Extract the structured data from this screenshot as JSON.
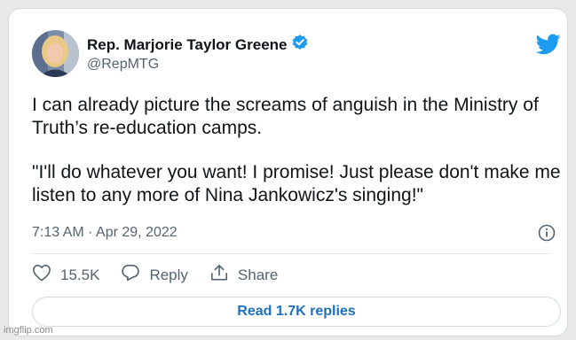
{
  "tweet": {
    "author_name": "Rep. Marjorie Taylor Greene",
    "handle": "@RepMTG",
    "verified": true,
    "paragraphs": [
      "I can already picture the screams of anguish in the Ministry of Truth’s re-education camps.",
      "\"I'll do whatever you want! I promise! Just please don't make me listen to any more of Nina Jankowicz's singing!\""
    ],
    "timestamp": "7:13 AM · Apr 29, 2022",
    "likes": "15.5K",
    "reply_label": "Reply",
    "share_label": "Share",
    "read_replies_label": "Read 1.7K replies"
  },
  "icons": {
    "brand": "twitter-bird-icon",
    "verified": "verified-badge-icon",
    "info": "info-icon",
    "like": "heart-icon",
    "reply": "reply-bubble-icon",
    "share": "share-icon"
  },
  "colors": {
    "brand_blue": "#1d9bf0",
    "link_blue": "#1d6fc0",
    "text": "#0f1419",
    "muted": "#536471"
  },
  "watermark": "imgflip.com"
}
